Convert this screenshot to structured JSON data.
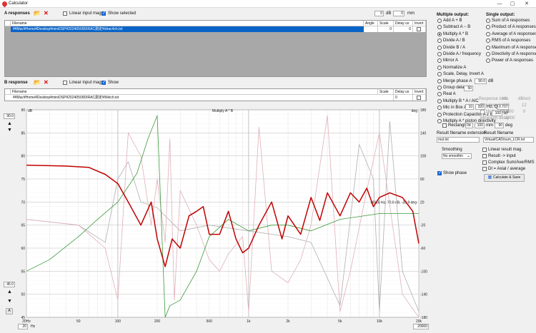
{
  "window": {
    "title": "Calculator",
    "minimize": "—",
    "maximize": "▢",
    "close": "✕"
  },
  "a_section": {
    "label": "A responses",
    "linear_input_mag": "Linear input mag.",
    "show_selected": "Show selected",
    "offset_db": "0",
    "db_unit": "dB",
    "offset_mm": "0",
    "mm_unit": "mm",
    "columns": {
      "filename": "Filename",
      "angle": "Angle",
      "scale_db": "Scale dB",
      "delay_us": "Delay us",
      "invert": "Invert"
    },
    "rows": [
      {
        "filename": "¥¥Mac¥Home¥Desktop¥miniDSP¥20240509DIRAC測定¥dirac4ch.txt",
        "angle": "",
        "scale_db": "0",
        "delay_us": "0"
      }
    ]
  },
  "b_section": {
    "label": "B response",
    "linear_input_mag": "Linear input mag.",
    "show": "Show",
    "columns": {
      "filename": "Filename",
      "scale_db": "Scale dB",
      "delay_us": "Delay us",
      "invert": "Invert"
    },
    "rows": [
      {
        "filename": "¥¥Mac¥Home¥Desktop¥miniDSP¥20240509DIRAC測定¥Welch.txt",
        "scale_db": "-77",
        "delay_us": "0"
      }
    ]
  },
  "multiple_output": {
    "heading": "Multiple output:",
    "options": [
      "Add A + B",
      "Subtract A − B",
      "Multiply A * B",
      "Divide A / B",
      "Divide B / A",
      "Divide A / frequency",
      "Mirror A",
      "Normalize A",
      "Scale, Delay, Invert A",
      "Merge phase A",
      "Group delay A",
      "Real A",
      "Multiply B * A / AIC",
      "Mic in Box A",
      "Protection Capacitor A z BIC",
      "Multiply A * piston directivity"
    ],
    "selected_index": 2,
    "mirror_value": "90.0",
    "mirror_unit": "dB",
    "normalize_value": "50",
    "mic_box": {
      "v1": "10",
      "v2": "320",
      "unit1": "Hz, Q",
      "v3": "0.707"
    },
    "protection": {
      "v1": "100",
      "unit": "uF"
    },
    "rectangle": "Rectangle",
    "rect_v1": "0d",
    "rect_v2": "100",
    "rect_unit": "mm",
    "rect_v3": "90",
    "rect_unit2": "deg"
  },
  "single_output": {
    "heading": "Single output:",
    "options": [
      "Sum of A responses",
      "Product of A responses",
      "Average of A responses",
      "RMS of A responses",
      "Maximum of A responses",
      "Directivity of A responses",
      "Power of A responses"
    ],
    "response_tools": "Response tools",
    "hz_label": "Hz",
    "dbs_label": "dB/oct",
    "lower_hz": "Lower tail",
    "lower_v1": "20",
    "lower_v2": "12",
    "higher_hz": "Higher tail",
    "higher_v1": "20000",
    "higher_v2": "0",
    "min_delay": "Minimum delay",
    "min_delay_v": "2000"
  },
  "result": {
    "ext_label": "Result filename extension",
    "ext_value": "mul.txt",
    "name_label": "Result filename",
    "name_value": "Virtual/CAD/sum_LCR.txt"
  },
  "smoothing": {
    "label": "Smoothing",
    "value": "No smoothin",
    "linear_result_mag": "Linear result mag.",
    "result_input": "Result -> input",
    "complex": "Complex Sum/Ave/RMS",
    "di_axial": "DI = Axial / average",
    "show_phase": "Show phase",
    "calc_save": "Calculate & Save"
  },
  "plot": {
    "title": "Multiply A * B",
    "left_top_value": "90.0",
    "left_bottom_value": "45.0",
    "a_label": "A",
    "hz_label": "Hz",
    "freq_start": "20",
    "freq_end": "20000",
    "cursor_readout": "18116 Hz, 70.0 dB, -33.9 deg",
    "db_unit": "dB",
    "deg_unit": "deg",
    "y_left": [
      "90",
      "85",
      "80",
      "75",
      "70",
      "65",
      "60",
      "55",
      "50",
      "45"
    ],
    "y_right": [
      "180",
      "140",
      "100",
      "60",
      "20",
      "-20",
      "-60",
      "-100",
      "-140",
      "-180"
    ],
    "x_ticks": [
      "20Hz",
      "50",
      "100",
      "200",
      "500",
      "1k",
      "2k",
      "5k",
      "10k",
      "20k"
    ]
  },
  "chart_data": {
    "type": "line",
    "title": "Multiply A * B",
    "xlabel": "",
    "ylabel": "dB",
    "xscale": "log",
    "xlim": [
      20,
      20000
    ],
    "ylim": [
      45,
      90
    ],
    "y2lim": [
      -180,
      180
    ],
    "series": [
      {
        "color": "#c00000",
        "axis": "left",
        "x": [
          20,
          40,
          60,
          80,
          100,
          120,
          150,
          180,
          200,
          230,
          260,
          300,
          350,
          400,
          450,
          500,
          600,
          700,
          800,
          900,
          1000,
          1200,
          1500,
          1800,
          2000,
          2500,
          3000,
          3500,
          4000,
          5000,
          6000,
          7000,
          8000,
          9000,
          10000,
          12000,
          15000,
          18000,
          20000
        ],
        "values": [
          78,
          77.8,
          77.5,
          76,
          74,
          70,
          65,
          70,
          62,
          56,
          62,
          60,
          67,
          68,
          69,
          63,
          63,
          68,
          62,
          59,
          60,
          65,
          70,
          62,
          67,
          63,
          71,
          66,
          72,
          67,
          72,
          70,
          73,
          69,
          71,
          72,
          71,
          68,
          61
        ]
      },
      {
        "color": "#3a9a3a",
        "axis": "right",
        "x": [
          20,
          30,
          50,
          70,
          100,
          140,
          170,
          200,
          230,
          250,
          300,
          400,
          500,
          700,
          1000,
          1500,
          2000,
          3000,
          5000,
          10000,
          20000
        ],
        "values": [
          -100,
          -80,
          -40,
          -10,
          20,
          70,
          130,
          170,
          -180,
          -160,
          -150,
          -100,
          -40,
          -10,
          -30,
          -20,
          -20,
          -30,
          -10,
          0,
          0
        ]
      },
      {
        "color": "#e0b0b8",
        "axis": "right",
        "x": [
          20,
          50,
          80,
          100,
          120,
          150,
          180,
          200,
          230,
          250,
          270,
          300,
          400,
          500,
          600,
          700,
          900,
          1000,
          1200,
          1500,
          2000,
          2500,
          3000,
          4000,
          5000,
          6000,
          8000,
          10000,
          15000,
          20000
        ],
        "values": [
          -10,
          -20,
          -60,
          -150,
          140,
          100,
          -20,
          60,
          -50,
          130,
          -150,
          40,
          -20,
          -80,
          -100,
          -70,
          -40,
          -170,
          150,
          -100,
          -120,
          -80,
          -20,
          170,
          -170,
          -100,
          40,
          140,
          -140,
          -180
        ]
      },
      {
        "color": "#b0b0b0",
        "axis": "right",
        "x": [
          20,
          50,
          80,
          100,
          120,
          150,
          200,
          300,
          500,
          1000,
          2000,
          3000,
          5000,
          7000,
          9000,
          10000,
          12000,
          15000,
          20000
        ],
        "values": [
          -10,
          -20,
          -50,
          60,
          90,
          20,
          10,
          -30,
          -20,
          -30,
          -40,
          -50,
          -160,
          120,
          60,
          -170,
          160,
          -100,
          -170
        ]
      }
    ]
  }
}
